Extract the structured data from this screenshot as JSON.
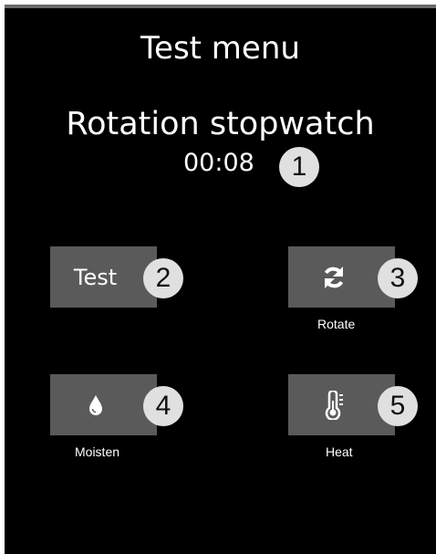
{
  "header": {
    "title": "Test menu"
  },
  "stopwatch": {
    "label": "Rotation stopwatch",
    "time": "00:08"
  },
  "callouts": [
    "1",
    "2",
    "3",
    "4",
    "5"
  ],
  "tiles": {
    "test": {
      "text": "Test"
    },
    "rotate": {
      "icon": "refresh-icon",
      "label": "Rotate"
    },
    "moisten": {
      "icon": "water-drop-icon",
      "label": "Moisten"
    },
    "heat": {
      "icon": "thermometer-icon",
      "label": "Heat"
    }
  },
  "colors": {
    "background": "#000000",
    "tile": "#5a5a5a",
    "callout": "#e0e0e0",
    "text": "#ffffff"
  }
}
